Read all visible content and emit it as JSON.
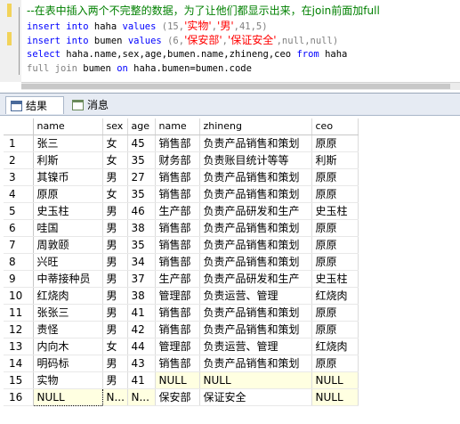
{
  "editor": {
    "comment": "--在表中插入两个不完整的数据，为了让他们都显示出来，在join前面加full",
    "line1": {
      "kw1": "insert",
      "kw2": "into",
      "table": "haha",
      "kw3": "values",
      "open": "(15,",
      "s1": "'实物'",
      "comma1": ",",
      "s2": "'男'",
      "rest": ",41,5)"
    },
    "line2": {
      "kw1": "insert",
      "kw2": "into",
      "table": "bumen",
      "kw3": "values",
      "open": "(6,",
      "s1": "'保安部'",
      "comma1": ",",
      "s2": "'保证安全'",
      "rest": ",null,null)"
    },
    "line3": {
      "kw1": "select",
      "cols": "haha.name,sex,age,bumen.name,zhineng,ceo",
      "kw2": "from",
      "table": "haha"
    },
    "line4": {
      "kw1": "full",
      "kw2": "join",
      "table": "bumen",
      "kw3": "on",
      "cond": "haha.bumen=bumen.code"
    }
  },
  "tabs": {
    "results": "结果",
    "messages": "消息"
  },
  "grid": {
    "headers": [
      "",
      "name",
      "sex",
      "age",
      "name",
      "zhineng",
      "ceo"
    ],
    "rows": [
      [
        "1",
        "张三",
        "女",
        "45",
        "销售部",
        "负责产品销售和策划",
        "原原"
      ],
      [
        "2",
        "利斯",
        "女",
        "35",
        "财务部",
        "负责账目统计等等",
        "利斯"
      ],
      [
        "3",
        "其镍币",
        "男",
        "27",
        "销售部",
        "负责产品销售和策划",
        "原原"
      ],
      [
        "4",
        "原原",
        "女",
        "35",
        "销售部",
        "负责产品销售和策划",
        "原原"
      ],
      [
        "5",
        "史玉柱",
        "男",
        "46",
        "生产部",
        "负责产品研发和生产",
        "史玉柱"
      ],
      [
        "6",
        "哇国",
        "男",
        "38",
        "销售部",
        "负责产品销售和策划",
        "原原"
      ],
      [
        "7",
        "周敦颐",
        "男",
        "35",
        "销售部",
        "负责产品销售和策划",
        "原原"
      ],
      [
        "8",
        "兴旺",
        "男",
        "34",
        "销售部",
        "负责产品销售和策划",
        "原原"
      ],
      [
        "9",
        "中蒂接种员",
        "男",
        "37",
        "生产部",
        "负责产品研发和生产",
        "史玉柱"
      ],
      [
        "10",
        "红烧肉",
        "男",
        "38",
        "管理部",
        "负责运营、管理",
        "红烧肉"
      ],
      [
        "11",
        "张张三",
        "男",
        "41",
        "销售部",
        "负责产品销售和策划",
        "原原"
      ],
      [
        "12",
        "责怪",
        "男",
        "42",
        "销售部",
        "负责产品销售和策划",
        "原原"
      ],
      [
        "13",
        "内向木",
        "女",
        "44",
        "管理部",
        "负责运营、管理",
        "红烧肉"
      ],
      [
        "14",
        "明码标",
        "男",
        "43",
        "销售部",
        "负责产品销售和策划",
        "原原"
      ],
      [
        "15",
        "实物",
        "男",
        "41",
        "NULL",
        "NULL",
        "NULL"
      ],
      [
        "16",
        "NULL",
        "N...",
        "N...",
        "保安部",
        "保证安全",
        "NULL"
      ]
    ]
  }
}
